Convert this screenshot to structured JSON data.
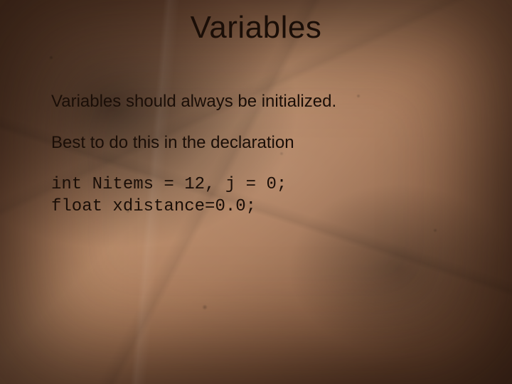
{
  "title": "Variables",
  "body": {
    "line1": "Variables should always be initialized.",
    "line2": "Best to do this in the declaration",
    "code1": "int Nitems = 12, j = 0;",
    "code2": "float xdistance=0.0;"
  }
}
